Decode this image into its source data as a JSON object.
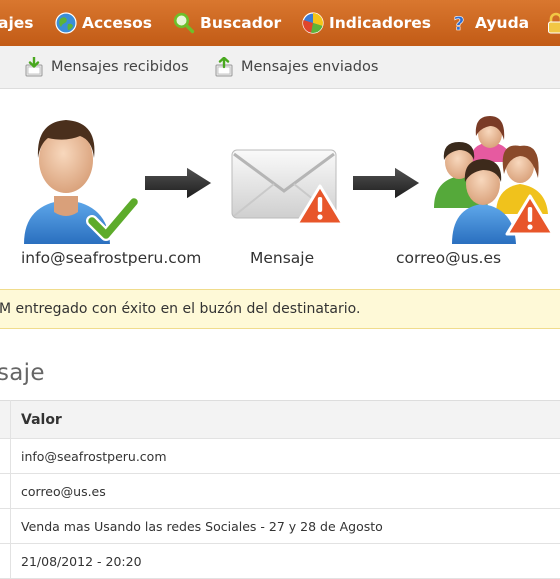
{
  "topnav": {
    "items": [
      {
        "label": "ajes"
      },
      {
        "label": "Accesos",
        "icon": "globe-icon"
      },
      {
        "label": "Buscador",
        "icon": "magnifier-icon"
      },
      {
        "label": "Indicadores",
        "icon": "pie-chart-icon"
      },
      {
        "label": "Ayuda",
        "icon": "help-icon"
      },
      {
        "icon": "lock-icon"
      }
    ]
  },
  "subnav": {
    "items": [
      {
        "label": "Mensajes recibidos",
        "icon": "inbox-download-icon"
      },
      {
        "label": "Mensajes enviados",
        "icon": "outbox-upload-icon"
      }
    ]
  },
  "flow": {
    "sender": "info@seafrostperu.com",
    "message": "Mensaje",
    "recipient": "correo@us.es"
  },
  "status": {
    "text": "M entregado con éxito en el buzón del destinatario."
  },
  "section": {
    "title": "saje"
  },
  "table": {
    "header": {
      "value": "Valor"
    },
    "rows": [
      {
        "value": "info@seafrostperu.com"
      },
      {
        "value": "correo@us.es"
      },
      {
        "value": "Venda mas Usando las redes Sociales - 27 y 28 de Agosto"
      },
      {
        "value": "21/08/2012 - 20:20"
      }
    ]
  },
  "colors": {
    "nav_bg": "#c9631e",
    "status_bg": "#fef9d7",
    "check_green": "#5dab2b",
    "warning_orange": "#e8562a"
  }
}
